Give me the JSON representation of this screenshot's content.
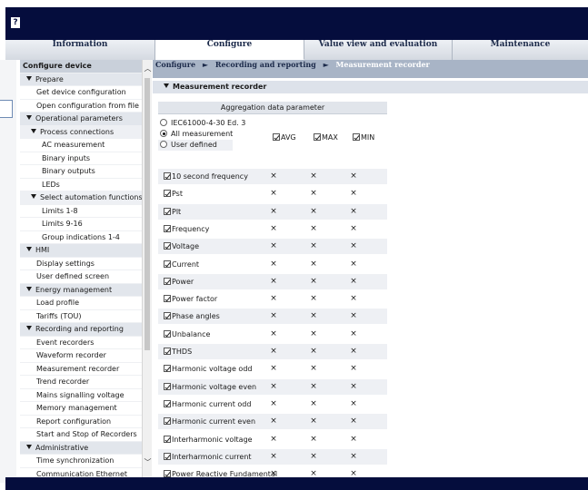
{
  "app": {
    "logo_glyph": "?"
  },
  "tabs": [
    {
      "label": "Information",
      "active": false
    },
    {
      "label": "Configure",
      "active": true
    },
    {
      "label": "Value view and evaluation",
      "active": false
    },
    {
      "label": "Maintenance",
      "active": false
    }
  ],
  "sidebar": {
    "items": [
      {
        "label": "Configure device",
        "level": "h0"
      },
      {
        "label": "Prepare",
        "level": "h1",
        "expanded": true
      },
      {
        "label": "Get device configuration",
        "level": "i1"
      },
      {
        "label": "Open configuration from file",
        "level": "i1"
      },
      {
        "label": "Operational parameters",
        "level": "h1",
        "expanded": true
      },
      {
        "label": "Process connections",
        "level": "h2",
        "expanded": true
      },
      {
        "label": "AC measurement",
        "level": "i2"
      },
      {
        "label": "Binary inputs",
        "level": "i2"
      },
      {
        "label": "Binary outputs",
        "level": "i2"
      },
      {
        "label": "LEDs",
        "level": "i2"
      },
      {
        "label": "Select automation functions",
        "level": "h2",
        "expanded": true
      },
      {
        "label": "Limits 1-8",
        "level": "i2"
      },
      {
        "label": "Limits 9-16",
        "level": "i2"
      },
      {
        "label": "Group indications 1-4",
        "level": "i2"
      },
      {
        "label": "HMI",
        "level": "h1",
        "expanded": true
      },
      {
        "label": "Display settings",
        "level": "i1"
      },
      {
        "label": "User defined screen",
        "level": "i1"
      },
      {
        "label": "Energy management",
        "level": "h1",
        "expanded": true
      },
      {
        "label": "Load profile",
        "level": "i1"
      },
      {
        "label": "Tariffs (TOU)",
        "level": "i1"
      },
      {
        "label": "Recording and reporting",
        "level": "h1",
        "expanded": true
      },
      {
        "label": "Event recorders",
        "level": "i1"
      },
      {
        "label": "Waveform recorder",
        "level": "i1"
      },
      {
        "label": "Measurement recorder",
        "level": "i1"
      },
      {
        "label": "Trend recorder",
        "level": "i1"
      },
      {
        "label": "Mains signalling voltage",
        "level": "i1"
      },
      {
        "label": "Memory management",
        "level": "i1"
      },
      {
        "label": "Report configuration",
        "level": "i1"
      },
      {
        "label": "Start and Stop of Recorders",
        "level": "i1"
      },
      {
        "label": "Administrative",
        "level": "h1",
        "expanded": true
      },
      {
        "label": "Time synchronization",
        "level": "i1"
      },
      {
        "label": "Communication Ethernet",
        "level": "i1"
      }
    ]
  },
  "breadcrumb": {
    "items": [
      "Configure",
      "Recording and reporting",
      "Measurement recorder"
    ],
    "separator": "►"
  },
  "section": {
    "title": "Measurement recorder"
  },
  "aggregation": {
    "header": "Aggregation data parameter",
    "options": [
      {
        "label": "IEC61000-4-30 Ed. 3",
        "selected": false
      },
      {
        "label": "All measurement",
        "selected": true
      },
      {
        "label": "User defined",
        "selected": false
      }
    ],
    "columns": [
      "AVG",
      "MAX",
      "MIN"
    ],
    "mark": "×",
    "parameters": [
      "10 second frequency",
      "Pst",
      "Plt",
      "Frequency",
      "Voltage",
      "Current",
      "Power",
      "Power factor",
      "Phase angles",
      "Unbalance",
      "THDS",
      "Harmonic voltage odd",
      "Harmonic voltage even",
      "Harmonic current odd",
      "Harmonic current even",
      "Interharmonic voltage",
      "Interharmonic current",
      "Power Reactive Fundamental"
    ]
  },
  "colors": {
    "titlebar": "#050d3d",
    "breadcrumb_bg": "#a8b4c6",
    "group_header": "#c9d0da"
  }
}
